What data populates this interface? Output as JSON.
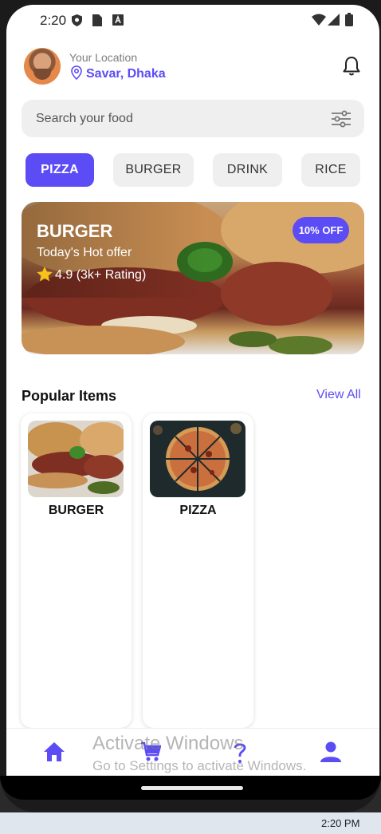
{
  "status_bar": {
    "time": "2:20"
  },
  "header": {
    "location_label": "Your Location",
    "location_value": "Savar, Dhaka"
  },
  "search": {
    "placeholder": "Search your food"
  },
  "categories": [
    {
      "label": "PIZZA",
      "active": true
    },
    {
      "label": "BURGER",
      "active": false
    },
    {
      "label": "DRINK",
      "active": false
    },
    {
      "label": "RICE",
      "active": false
    }
  ],
  "banner": {
    "title": "BURGER",
    "subtitle": "Today's Hot offer",
    "rating": "4.9 (3k+ Rating)",
    "badge": "10% OFF"
  },
  "popular": {
    "title": "Popular Items",
    "view_all": "View All",
    "items": [
      {
        "name": "BURGER"
      },
      {
        "name": "PIZZA"
      }
    ]
  },
  "nav": {
    "items": [
      "home-icon",
      "cart-icon",
      "help-icon",
      "profile-icon"
    ]
  },
  "watermark": {
    "line1": "Activate Windows",
    "line2": "Go to Settings to activate Windows."
  },
  "taskbar": {
    "time": "2:20 PM"
  },
  "colors": {
    "accent": "#5b4cf5",
    "chip_bg": "#efefef"
  }
}
